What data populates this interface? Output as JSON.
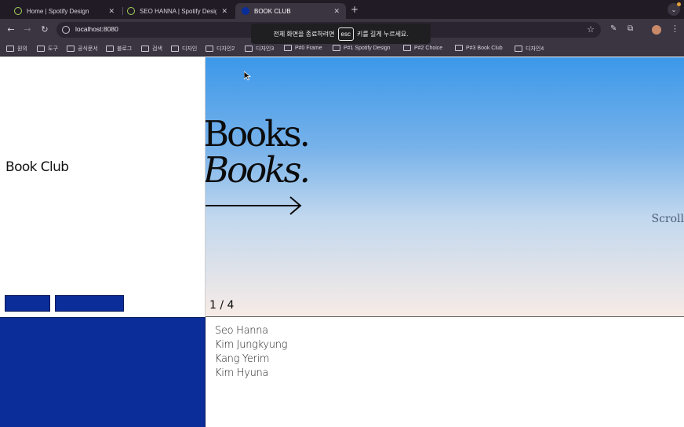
{
  "browser": {
    "tabs": [
      {
        "title": "Home | Spotify Design",
        "favicon": "spotify-icon",
        "active": false
      },
      {
        "title": "SEO HANNA | Spotify Design",
        "favicon": "spotify-icon",
        "active": false
      },
      {
        "title": "BOOK CLUB",
        "favicon": "bookclub-icon",
        "active": true
      }
    ],
    "url": "localhost:8080",
    "fullscreen_notice": {
      "before": "전체 화면을 종료하려면",
      "key": "esc",
      "after": "키를 길게 누르세요."
    },
    "bookmarks": [
      "원의",
      "도구",
      "공식문서",
      "블로그",
      "검색",
      "디자인",
      "디자인2",
      "디자인3",
      "P#0 Frame",
      "P#1 Spotify Design",
      "P#2 Choice",
      "P#3 Book Club",
      "디자인4"
    ]
  },
  "site": {
    "title": "Book Club",
    "hero": {
      "line1": "Books.",
      "line2": "Books.",
      "scroll_label": "Scroll",
      "counter": "1 / 4"
    },
    "members": [
      "Seo Hanna",
      "Kim Jungkyung",
      "Kang Yerim",
      "Kim Hyuna"
    ]
  },
  "colors": {
    "accent_blue": "#0b2d99",
    "hero_top": "#3c98ea",
    "hero_bottom": "#f7ebe6",
    "chrome_dark": "#201b25",
    "chrome_toolbar": "#3b3542"
  }
}
